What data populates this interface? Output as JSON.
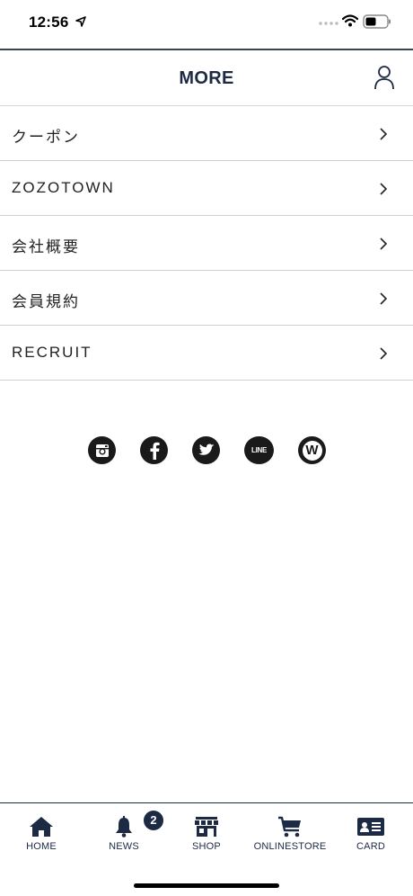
{
  "status_bar": {
    "time": "12:56"
  },
  "header": {
    "title": "MORE"
  },
  "menu": [
    {
      "label": "クーポン"
    },
    {
      "label": "ZOZOTOWN"
    },
    {
      "label": "会社概要"
    },
    {
      "label": "会員規約"
    },
    {
      "label": "RECRUIT"
    }
  ],
  "social": [
    {
      "icon": "instagram-icon"
    },
    {
      "icon": "facebook-icon"
    },
    {
      "icon": "twitter-icon"
    },
    {
      "icon": "line-icon",
      "text": "LINE"
    },
    {
      "icon": "wear-icon",
      "text": "W"
    }
  ],
  "tabs": [
    {
      "label": "HOME",
      "icon": "home-icon"
    },
    {
      "label": "NEWS",
      "icon": "bell-icon"
    },
    {
      "label": "SHOP",
      "icon": "store-icon"
    },
    {
      "label": "ONLINESTORE",
      "icon": "cart-icon"
    },
    {
      "label": "CARD",
      "icon": "card-icon"
    }
  ],
  "news_badge": "2",
  "colors": {
    "primary": "#1c2a44",
    "divider": "#cfcfcf"
  }
}
